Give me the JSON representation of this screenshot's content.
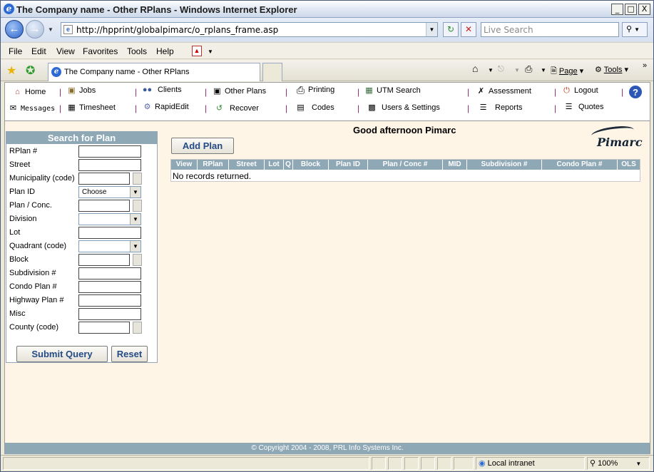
{
  "window": {
    "title": "The Company name - Other RPlans - Windows Internet Explorer",
    "minimize": "_",
    "maximize": "□",
    "close": "X"
  },
  "address": {
    "url": "http://hpprint/globalpimarc/o_rplans_frame.asp",
    "search_placeholder": "Live Search"
  },
  "menu": [
    "File",
    "Edit",
    "View",
    "Favorites",
    "Tools",
    "Help"
  ],
  "tab": {
    "title": "The Company name - Other RPlans"
  },
  "command_bar": {
    "page": "Page",
    "tools": "Tools"
  },
  "app_nav": {
    "row1": [
      "Home",
      "Jobs",
      "Clients",
      "Other Plans",
      "Printing",
      "UTM Search",
      "Assessment",
      "Logout"
    ],
    "row2": [
      "Messages",
      "Timesheet",
      "RapidEdit",
      "Recover",
      "Codes",
      "Users & Settings",
      "Reports",
      "Quotes"
    ],
    "separator": "|"
  },
  "search": {
    "title": "Search for Plan",
    "fields": {
      "rplan": "RPlan #",
      "street": "Street",
      "municipality": "Municipality (code)",
      "plan_id": "Plan ID",
      "plan_conc": "Plan / Conc.",
      "division": "Division",
      "lot": "Lot",
      "quadrant": "Quadrant (code)",
      "block": "Block",
      "subdivision": "Subdivision #",
      "condo_plan": "Condo Plan #",
      "highway_plan": "Highway Plan #",
      "misc": "Misc",
      "county": "County (code)"
    },
    "plan_id_value": "Choose",
    "submit": "Submit Query",
    "reset": "Reset"
  },
  "main": {
    "greeting": "Good afternoon Pimarc",
    "logo_text": "Pimarc",
    "add_plan": "Add Plan",
    "columns": [
      "View",
      "RPlan",
      "Street",
      "Lot",
      "Q",
      "Block",
      "Plan ID",
      "Plan / Conc #",
      "MID",
      "Subdivision #",
      "Condo Plan #",
      "OLS"
    ],
    "empty_message": "No records returned."
  },
  "footer": {
    "copyright": "© Copyright 2004 - 2008, PRL Info Systems Inc."
  },
  "statusbar": {
    "zone": "Local intranet",
    "zoom": "100%"
  }
}
